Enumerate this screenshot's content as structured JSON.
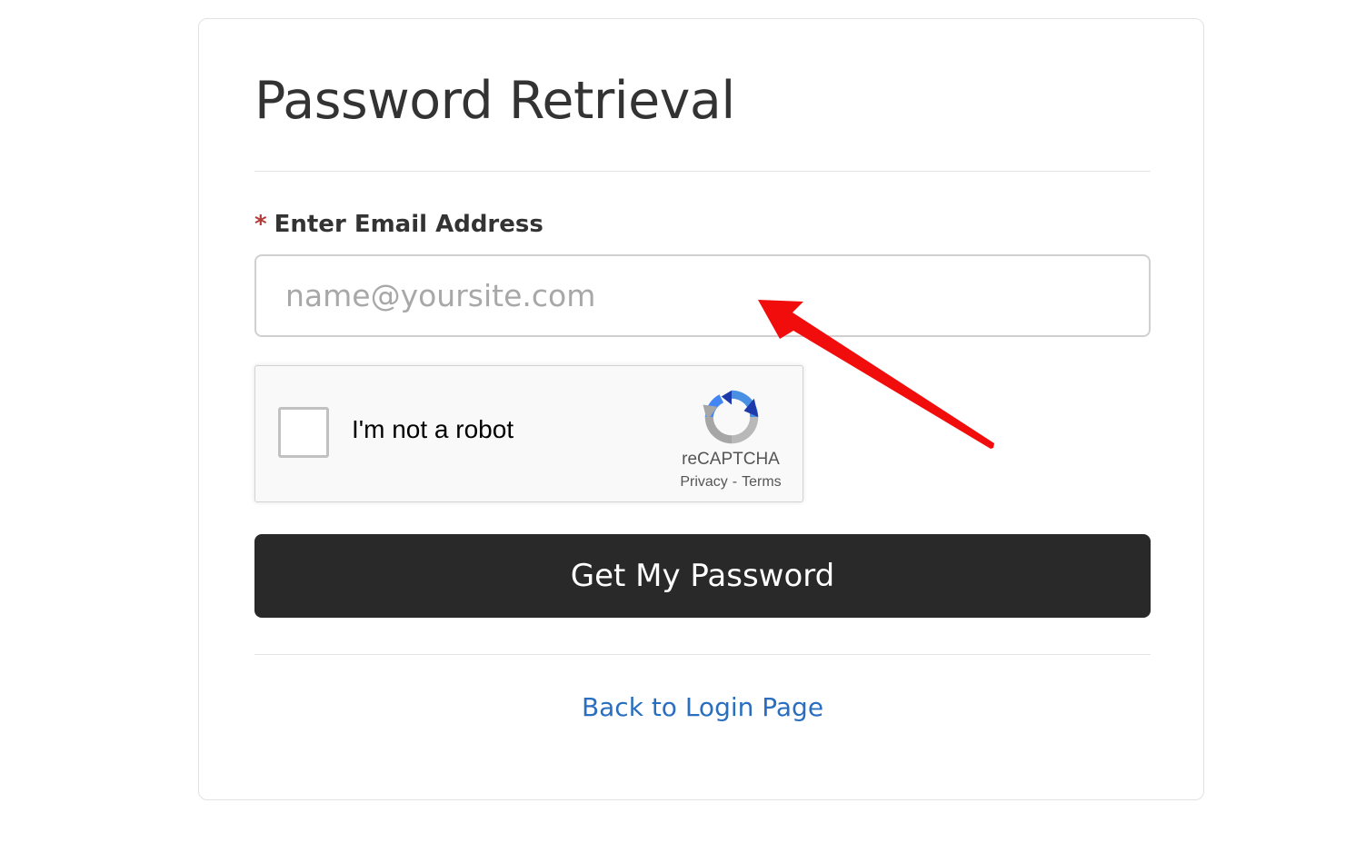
{
  "page": {
    "title": "Password Retrieval"
  },
  "form": {
    "required_marker": "*",
    "email_label": "Enter Email Address",
    "email_placeholder": "name@yoursite.com",
    "email_value": "",
    "submit_label": "Get My Password"
  },
  "captcha": {
    "checkbox_label": "I'm not a robot",
    "checked": false,
    "brand": "reCAPTCHA",
    "privacy_label": "Privacy",
    "separator": "-",
    "terms_label": "Terms",
    "icon": "recaptcha-logo-icon"
  },
  "footer": {
    "back_link_label": "Back to Login Page"
  },
  "annotation": {
    "icon": "red-arrow-icon",
    "color": "#f20d0d"
  },
  "colors": {
    "button_bg": "#292929",
    "link": "#2a6ebf",
    "required": "#b53b3b"
  }
}
